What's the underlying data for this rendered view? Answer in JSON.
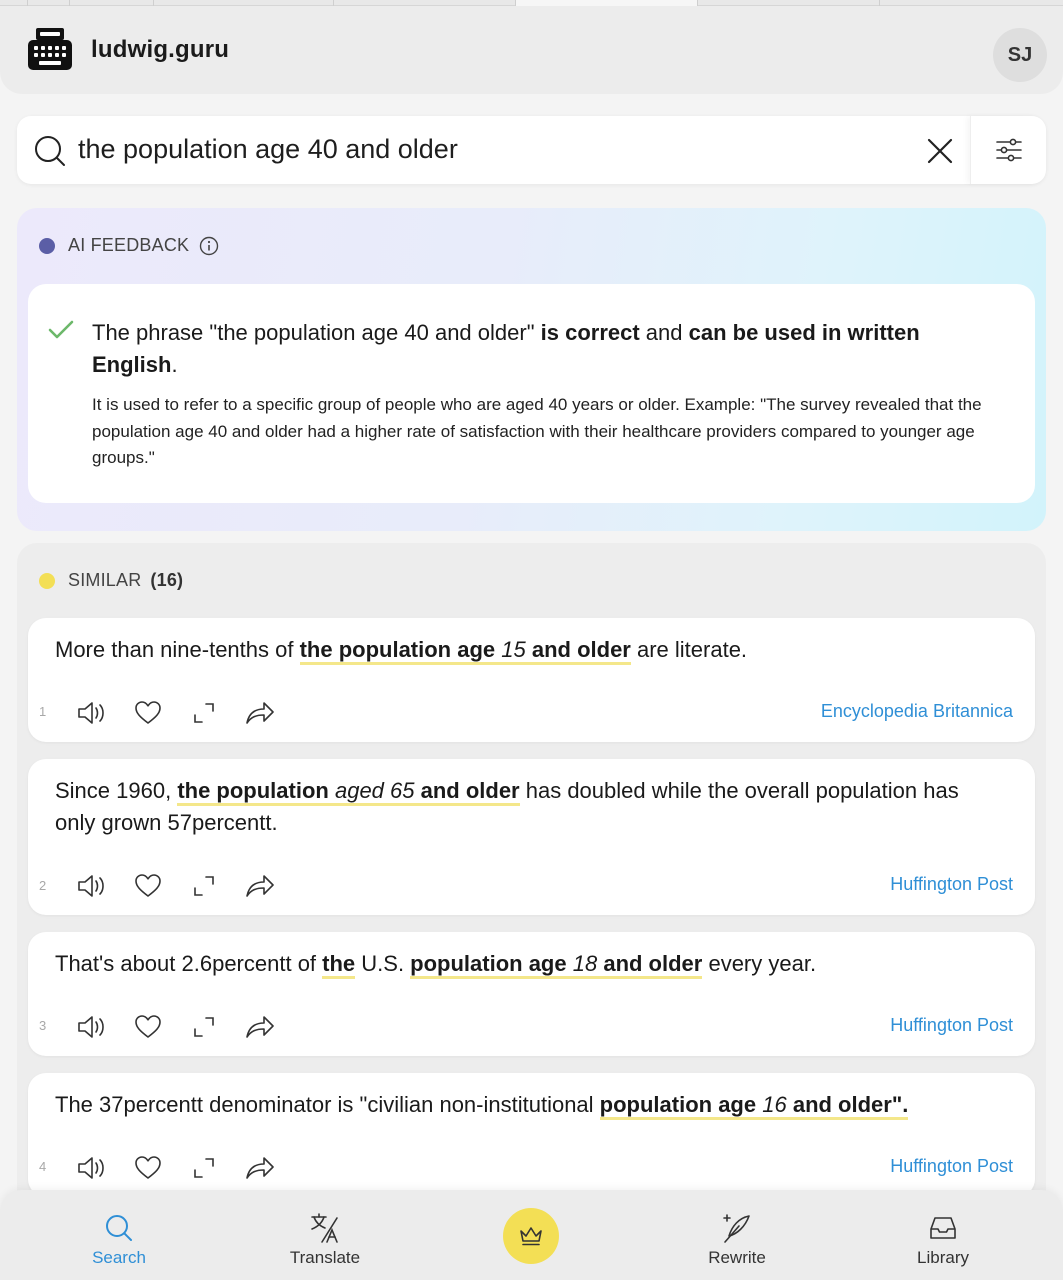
{
  "app": {
    "site_name": "ludwig.guru",
    "avatar_initials": "SJ"
  },
  "search": {
    "query": "the population age 40 and older"
  },
  "ai_feedback": {
    "label": "AI FEEDBACK",
    "dot_color": "#5b5ea6",
    "summary_parts": [
      {
        "t": "The phrase \"the population age 40 and older\" ",
        "b": false
      },
      {
        "t": "is correct",
        "b": true
      },
      {
        "t": " and ",
        "b": false
      },
      {
        "t": "can be used in written English",
        "b": true
      },
      {
        "t": ".",
        "b": false
      }
    ],
    "detail": "It is used to refer to a specific group of people who are aged 40 years or older. Example: \"The survey revealed that the population age 40 and older had a higher rate of satisfaction with their healthcare providers compared to younger age groups.\""
  },
  "similar": {
    "label": "SIMILAR",
    "count": "(16)",
    "dot_color": "#f3df55",
    "examples": [
      {
        "num": "1",
        "source": "Encyclopedia Britannica",
        "segments": [
          {
            "t": "More than nine-tenths of ",
            "hl": false
          },
          {
            "t": "the population age ",
            "hl": true
          },
          {
            "t": "15",
            "hl": true,
            "i": true
          },
          {
            "t": " and older",
            "hl": true
          },
          {
            "t": " are literate.",
            "hl": false
          }
        ]
      },
      {
        "num": "2",
        "source": "Huffington Post",
        "segments": [
          {
            "t": "Since 1960, ",
            "hl": false
          },
          {
            "t": "the population ",
            "hl": true
          },
          {
            "t": "aged 65",
            "hl": true,
            "i": true
          },
          {
            "t": " and older",
            "hl": true
          },
          {
            "t": " has doubled while the overall population has only grown 57percentt.",
            "hl": false
          }
        ]
      },
      {
        "num": "3",
        "source": "Huffington Post",
        "segments": [
          {
            "t": "That's about 2.6percentt of ",
            "hl": false
          },
          {
            "t": "the",
            "hl": true
          },
          {
            "t": " U.S. ",
            "hl": false
          },
          {
            "t": "population age ",
            "hl": true
          },
          {
            "t": "18",
            "hl": true,
            "i": true
          },
          {
            "t": " and older",
            "hl": true
          },
          {
            "t": " every year.",
            "hl": false
          }
        ]
      },
      {
        "num": "4",
        "source": "Huffington Post",
        "segments": [
          {
            "t": "The 37percentt denominator is \"civilian non-institutional ",
            "hl": false
          },
          {
            "t": "population age ",
            "hl": true
          },
          {
            "t": "16",
            "hl": true,
            "i": true
          },
          {
            "t": " and older\".",
            "hl": true
          }
        ]
      }
    ]
  },
  "nav": {
    "search": "Search",
    "translate": "Translate",
    "rewrite": "Rewrite",
    "library": "Library",
    "active_color": "#2f8fd6",
    "premium_color": "#f3df55"
  }
}
